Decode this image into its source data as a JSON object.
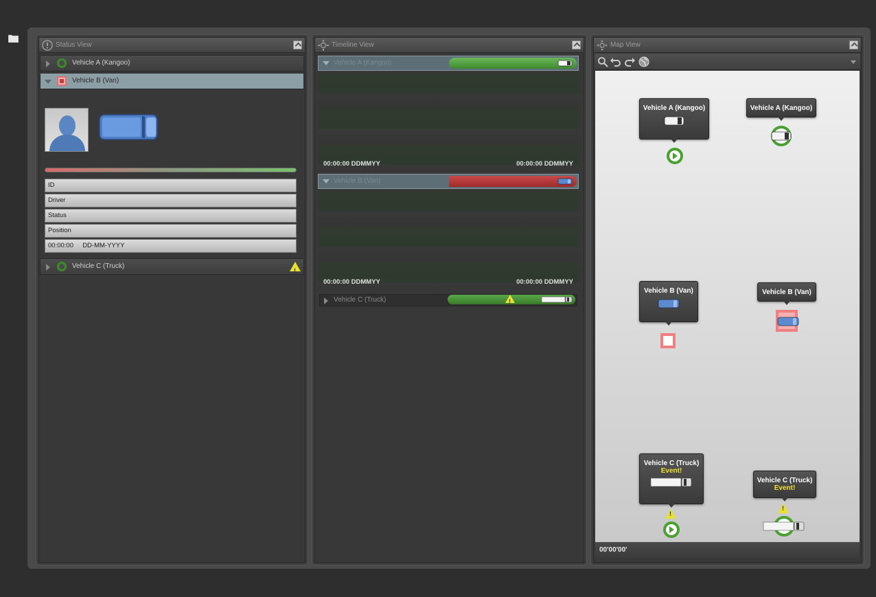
{
  "status_panel": {
    "title": "Status View",
    "vehicles": [
      {
        "label": "Vehicle A (Kangoo)",
        "state": "ok",
        "expanded": false
      },
      {
        "label": "Vehicle B (Van)",
        "state": "alert",
        "expanded": true
      },
      {
        "label": "Vehicle C (Truck)",
        "state": "ok",
        "expanded": false,
        "warning": true
      }
    ],
    "health_bar_fill": 1.0,
    "fields": {
      "id": "ID",
      "driver": "Driver",
      "status": "Status",
      "position": "Position",
      "time": "00:00:00",
      "date": "DD-MM-YYYY"
    }
  },
  "timeline_panel": {
    "title": "Timeline View",
    "rows": [
      {
        "label": "Vehicle A (Kangoo)",
        "start": "00:00:00 DDMMYY",
        "end": "00:00:00 DDMMYY",
        "bar_color": "#4a9a3a"
      },
      {
        "label": "Vehicle B (Van)",
        "start": "00:00:00 DDMMYY",
        "end": "00:00:00 DDMMYY",
        "bar_color": "#b83838"
      },
      {
        "label": "Vehicle C (Truck)",
        "bar_color": "#4a9a3a"
      }
    ]
  },
  "map_panel": {
    "title": "Map View",
    "footer_time": "00'00'00'",
    "callouts": {
      "a1": "Vehicle A (Kangoo)",
      "a2": "Vehicle A (Kangoo)",
      "b1": "Vehicle B (Van)",
      "b2": "Vehicle B (Van)",
      "c1": "Vehicle C (Truck)",
      "c1_event": "Event!",
      "c2": "Vehicle C (Truck)",
      "c2_event": "Event!"
    }
  },
  "colors": {
    "ok": "#3d8a2a",
    "alert": "#c04040",
    "warning": "#e8e030",
    "selected_row": "#8c9ea6"
  }
}
